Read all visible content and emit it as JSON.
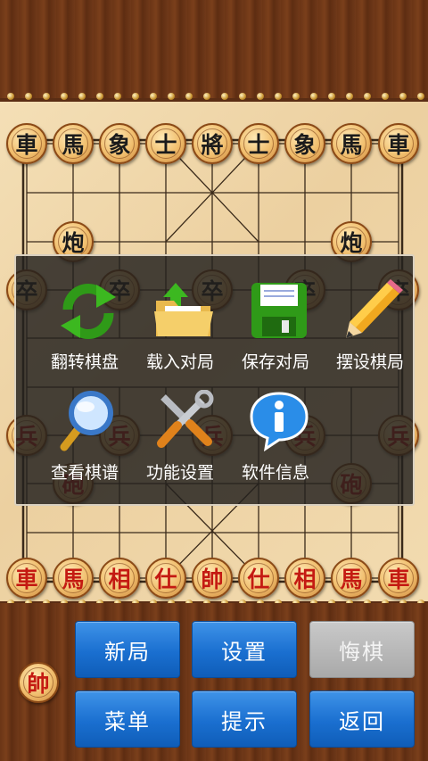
{
  "colors": {
    "black_piece": "#1b1b1b",
    "red_piece": "#c41a12",
    "button_blue": "#1a6fd0",
    "button_disabled": "#a9a9a9"
  },
  "board": {
    "black_back_row": [
      "車",
      "馬",
      "象",
      "士",
      "將",
      "士",
      "象",
      "馬",
      "車"
    ],
    "black_cannons": [
      "炮",
      "炮"
    ],
    "black_pawns": [
      "卒",
      "卒",
      "卒",
      "卒",
      "卒"
    ],
    "red_pawns": [
      "兵",
      "兵",
      "兵",
      "兵",
      "兵"
    ],
    "red_cannons": [
      "砲",
      "砲"
    ],
    "red_back_row": [
      "車",
      "馬",
      "相",
      "仕",
      "帥",
      "仕",
      "相",
      "馬",
      "車"
    ]
  },
  "menu": {
    "items": [
      {
        "label": "翻转棋盘",
        "icon": "refresh-arrows-icon"
      },
      {
        "label": "载入对局",
        "icon": "folder-load-icon"
      },
      {
        "label": "保存对局",
        "icon": "floppy-disk-icon"
      },
      {
        "label": "摆设棋局",
        "icon": "pencil-icon"
      },
      {
        "label": "查看棋谱",
        "icon": "magnifier-icon"
      },
      {
        "label": "功能设置",
        "icon": "tools-icon"
      },
      {
        "label": "软件信息",
        "icon": "info-bubble-icon"
      }
    ]
  },
  "status": {
    "turn_piece": "帥"
  },
  "buttons": {
    "new_game": "新局",
    "settings": "设置",
    "undo": "悔棋",
    "menu": "菜单",
    "hint": "提示",
    "back": "返回"
  }
}
